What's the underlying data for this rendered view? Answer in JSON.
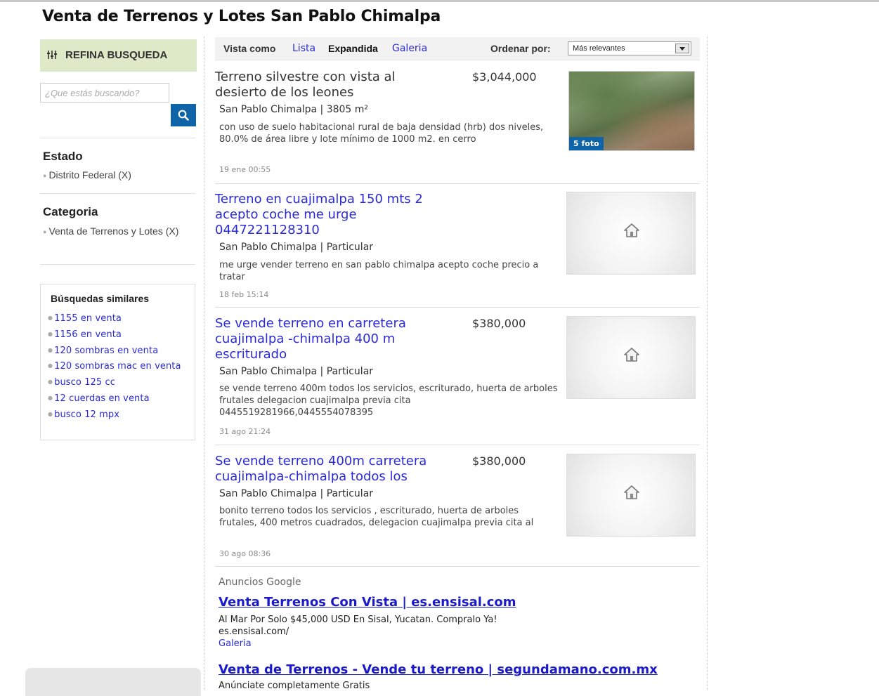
{
  "page": {
    "title": "Venta de Terrenos y Lotes San Pablo Chimalpa"
  },
  "sidebar": {
    "refine_label": "REFINA BUSQUEDA",
    "search_placeholder": "¿Que estás buscando?",
    "facets": [
      {
        "title": "Estado",
        "items": [
          "Distrito Federal  (X)"
        ]
      },
      {
        "title": "Categoria",
        "items": [
          "Venta de Terrenos y Lotes (X)"
        ]
      }
    ],
    "similar": {
      "title": "Búsquedas similares",
      "items": [
        "1155 en venta",
        "1156 en venta",
        "120 sombras en venta",
        "120 sombras mac en venta",
        "busco 125 cc",
        "12 cuerdas en venta",
        "busco 12 mpx"
      ]
    }
  },
  "toolbar": {
    "view_label": "Vista como",
    "view_options": [
      "Lista",
      "Expandida",
      "Galeria"
    ],
    "view_selected": "Expandida",
    "order_label": "Ordenar por:",
    "order_value": "Más relevantes"
  },
  "listings": [
    {
      "title": "Terreno silvestre con vista al desierto de los leones",
      "price": "$3,044,000",
      "location": "San Pablo Chimalpa | 3805 m²",
      "description": "con uso de suelo habitacional rural de baja densidad (hrb) dos niveles, 80.0% de área libre y lote mínimo de 1000 m2. en cerro",
      "date": "19 ene 00:55",
      "photo_badge": "5 foto"
    },
    {
      "title": "Terreno en cuajimalpa 150 mts 2 acepto coche me urge 0447221128310",
      "price": "",
      "location": "San Pablo Chimalpa | Particular",
      "description": "me urge vender terreno en san pablo chimalpa acepto coche precio a tratar",
      "date": "18 feb 15:14"
    },
    {
      "title": "Se vende terreno en carretera cuajimalpa -chimalpa 400 m escriturado",
      "price": "$380,000",
      "location": "San Pablo Chimalpa | Particular",
      "description": "se vende terreno 400m todos los servicios, escriturado, huerta de arboles frutales delegacion cuajimalpa previa cita 0445519281966,0445554078395",
      "date": "31 ago 21:24"
    },
    {
      "title": "Se vende terreno 400m carretera cuajimalpa-chimalpa todos los",
      "price": "$380,000",
      "location": "San Pablo Chimalpa | Particular",
      "description": "bonito terreno todos los servicios , escriturado, huerta de arboles frutales, 400 metros cuadrados, delegacion cuajimalpa previa cita al",
      "date": "30 ago 08:36"
    }
  ],
  "ads": {
    "label": "Anuncios Google",
    "items": [
      {
        "title": "Venta Terrenos Con Vista | es.ensisal.com",
        "text": "Al Mar Por Solo $45,000 USD En Sisal, Yucatan. Compralo Ya!",
        "url": "es.ensisal.com/",
        "link": "Galeria"
      },
      {
        "title": "Venta de Terrenos - Vende tu terreno | segundamano.com.mx",
        "text": "Anúnciate completamente Gratis"
      }
    ]
  },
  "icons": {
    "refine": "sliders-icon",
    "search": "search-icon",
    "placeholder": "house-icon"
  },
  "colors": {
    "link": "#2a2ad8",
    "refine_bg": "#dde9c7",
    "search_button": "#0f64a8",
    "badge": "#0f64a8"
  }
}
